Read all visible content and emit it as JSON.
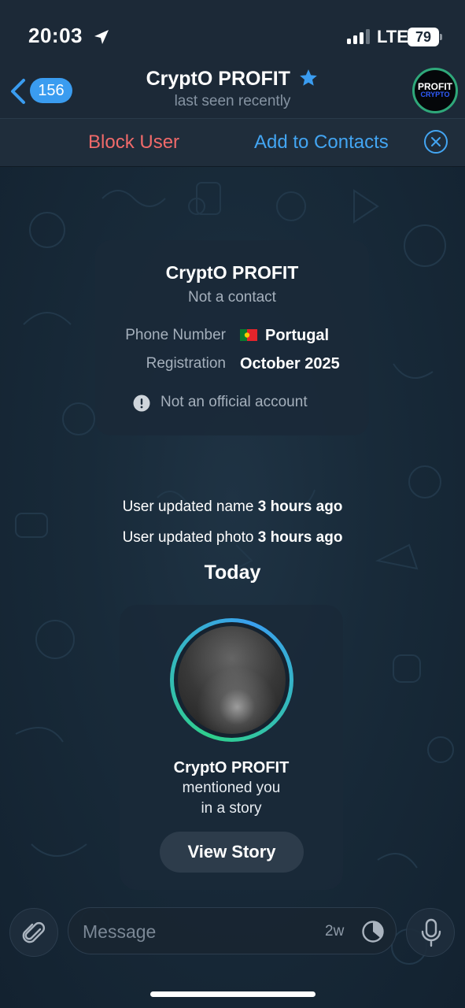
{
  "status_bar": {
    "time": "20:03",
    "network": "LTE",
    "battery": "79",
    "icons": [
      "location-arrow-icon",
      "signal-bars-icon",
      "battery-icon"
    ]
  },
  "header": {
    "unread_count": "156",
    "title": "CryptO PROFIT",
    "subtitle": "last seen recently",
    "avatar_text_top": "PROFIT",
    "avatar_text_bottom": "CRYPTO"
  },
  "action_bar": {
    "block_label": "Block User",
    "add_label": "Add to Contacts"
  },
  "info_card": {
    "name": "CryptO PROFIT",
    "status": "Not a contact",
    "rows": [
      {
        "label": "Phone Number",
        "value": "Portugal"
      },
      {
        "label": "Registration",
        "value": "October 2025"
      }
    ],
    "warning": "Not an official account"
  },
  "service": {
    "name_prefix": "User updated name ",
    "name_time": "3 hours ago",
    "photo_prefix": "User updated photo ",
    "photo_time": "3 hours ago",
    "date": "Today"
  },
  "story": {
    "name": "CryptO PROFIT",
    "line1": "mentioned you",
    "line2": "in a story",
    "button": "View Story"
  },
  "composer": {
    "placeholder": "Message",
    "timer": "2w"
  },
  "colors": {
    "accent": "#3a9cf0",
    "danger": "#f06a6a",
    "background": "#15222f"
  }
}
